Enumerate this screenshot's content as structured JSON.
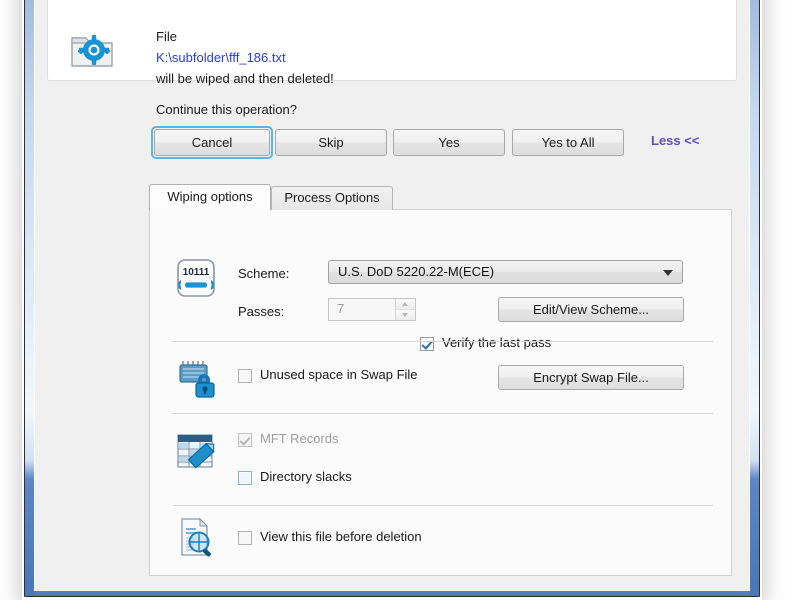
{
  "dialog": {
    "message": {
      "file_label": "File",
      "file_path": "K:\\subfolder\\fff_186.txt",
      "action_text": "will be wiped and then deleted!",
      "question": "Continue this operation?",
      "icon": "folder-gear-icon",
      "path_color": "#2a3fd0"
    },
    "buttons": {
      "cancel": "Cancel",
      "skip": "Skip",
      "yes": "Yes",
      "yes_to_all": "Yes to All",
      "less_link": "Less <<",
      "default_focus": "cancel",
      "link_color": "#5b4fbe",
      "focus_ring_color": "#5fb4dd"
    },
    "tabs": [
      {
        "label": "Wiping options",
        "active": true
      },
      {
        "label": "Process Options",
        "active": false
      }
    ],
    "wiping_options": {
      "scheme_section": {
        "icon": "binary-wrench-icon",
        "scheme_label": "Scheme:",
        "scheme_value": "U.S. DoD 5220.22-M(ECE)",
        "passes_label": "Passes:",
        "passes_value": "7",
        "passes_disabled": true,
        "edit_scheme_button": "Edit/View Scheme...",
        "verify_checkbox": {
          "label": "Verify the last pass",
          "checked": true,
          "enabled": true
        }
      },
      "swap_section": {
        "icon": "chip-lock-icon",
        "checkbox": {
          "label": "Unused space in Swap File",
          "checked": false,
          "enabled": true
        },
        "encrypt_button": "Encrypt Swap File..."
      },
      "records_section": {
        "icon": "table-edit-icon",
        "mft_checkbox": {
          "label": "MFT Records",
          "checked": true,
          "enabled": false
        },
        "dirslack_checkbox": {
          "label": "Directory slacks",
          "checked": false,
          "enabled": true,
          "focused": true
        }
      },
      "view_section": {
        "icon": "document-magnifier-icon",
        "checkbox": {
          "label": "View this file before deletion",
          "checked": false,
          "enabled": true
        }
      }
    }
  }
}
